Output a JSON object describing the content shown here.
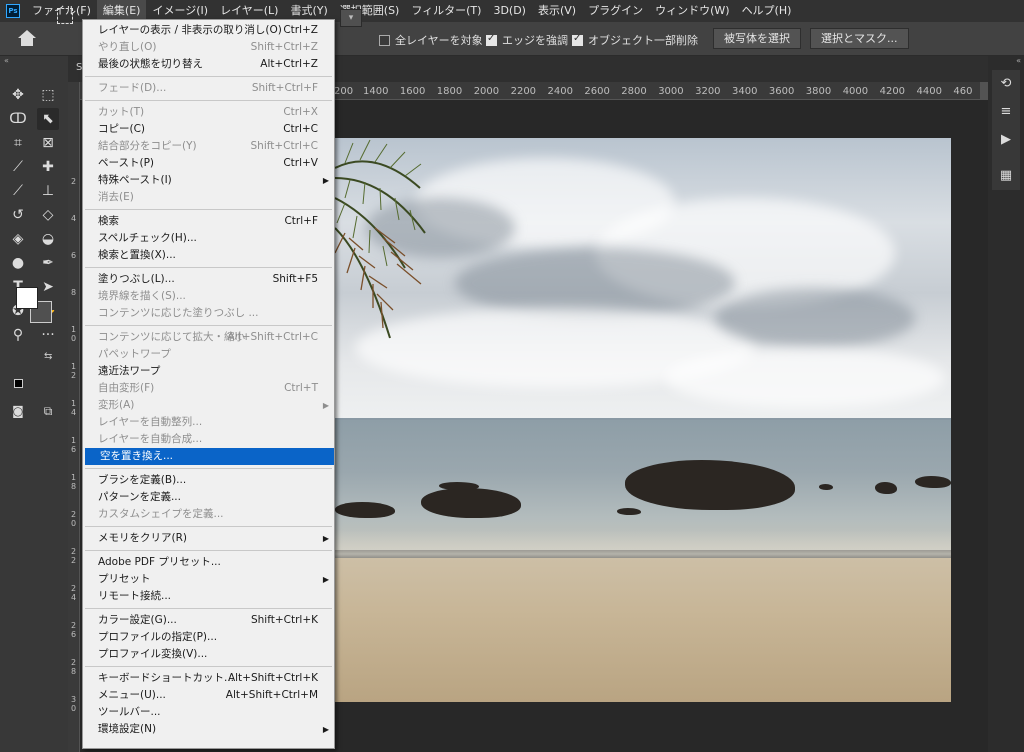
{
  "menubar": {
    "logo": "Ps",
    "items": [
      "ファイル(F)",
      "編集(E)",
      "イメージ(I)",
      "レイヤー(L)",
      "書式(Y)",
      "選択範囲(S)",
      "フィルター(T)",
      "3D(D)",
      "表示(V)",
      "プラグイン",
      "ウィンドウ(W)",
      "ヘルプ(H)"
    ],
    "active_index": 1
  },
  "options": {
    "all_layers": "全レイヤーを対象",
    "edge_enhance": "エッジを強調",
    "object_subtract": "オブジェクト一部削除",
    "select_subject": "被写体を選択",
    "select_and_mask": "選択とマスク..."
  },
  "checkboxes": {
    "all_layers": false,
    "edge_enhance": true,
    "object_subtract": true
  },
  "doc_tab": "S",
  "ruler": {
    "h_ticks": [
      "200",
      "1400",
      "1600",
      "1800",
      "2000",
      "2200",
      "2400",
      "2600",
      "2800",
      "3000",
      "3200",
      "3400",
      "3600",
      "3800",
      "4000",
      "4200",
      "4400",
      "460"
    ],
    "v_labels": [
      [
        "2"
      ],
      [
        "4"
      ],
      [
        "6"
      ],
      [
        "8"
      ],
      [
        "1",
        "0"
      ],
      [
        "1",
        "2"
      ],
      [
        "1",
        "4"
      ],
      [
        "1",
        "6"
      ],
      [
        "1",
        "8"
      ],
      [
        "2",
        "0"
      ],
      [
        "2",
        "2"
      ],
      [
        "2",
        "4"
      ],
      [
        "2",
        "6"
      ],
      [
        "2",
        "8"
      ],
      [
        "3",
        "0"
      ]
    ]
  },
  "colors": {
    "foreground": "#ffffff",
    "background": "#505050",
    "menu_highlight": "#0a64c8"
  },
  "edit_menu": {
    "items": [
      {
        "label": "レイヤーの表示 / 非表示の取り消し(O)",
        "shortcut": "Ctrl+Z",
        "disabled": false
      },
      {
        "label": "やり直し(O)",
        "shortcut": "Shift+Ctrl+Z",
        "disabled": true
      },
      {
        "label": "最後の状態を切り替え",
        "shortcut": "Alt+Ctrl+Z",
        "disabled": false
      },
      {
        "separator": true
      },
      {
        "label": "フェード(D)...",
        "shortcut": "Shift+Ctrl+F",
        "disabled": true
      },
      {
        "separator": true
      },
      {
        "label": "カット(T)",
        "shortcut": "Ctrl+X",
        "disabled": true
      },
      {
        "label": "コピー(C)",
        "shortcut": "Ctrl+C",
        "disabled": false
      },
      {
        "label": "結合部分をコピー(Y)",
        "shortcut": "Shift+Ctrl+C",
        "disabled": true
      },
      {
        "label": "ペースト(P)",
        "shortcut": "Ctrl+V",
        "disabled": false
      },
      {
        "label": "特殊ペースト(I)",
        "submenu": true,
        "disabled": false
      },
      {
        "label": "消去(E)",
        "disabled": true
      },
      {
        "separator": true
      },
      {
        "label": "検索",
        "shortcut": "Ctrl+F",
        "disabled": false
      },
      {
        "label": "スペルチェック(H)...",
        "disabled": false
      },
      {
        "label": "検索と置換(X)...",
        "disabled": false
      },
      {
        "separator": true
      },
      {
        "label": "塗りつぶし(L)...",
        "shortcut": "Shift+F5",
        "disabled": false
      },
      {
        "label": "境界線を描く(S)...",
        "disabled": true
      },
      {
        "label": "コンテンツに応じた塗りつぶし ...",
        "disabled": true
      },
      {
        "separator": true
      },
      {
        "label": "コンテンツに応じて拡大・縮小",
        "shortcut": "Alt+Shift+Ctrl+C",
        "disabled": true
      },
      {
        "label": "パペットワープ",
        "disabled": true
      },
      {
        "label": "遠近法ワープ",
        "disabled": false
      },
      {
        "label": "自由変形(F)",
        "shortcut": "Ctrl+T",
        "disabled": true
      },
      {
        "label": "変形(A)",
        "submenu": true,
        "disabled": true
      },
      {
        "label": "レイヤーを自動整列...",
        "disabled": true
      },
      {
        "label": "レイヤーを自動合成...",
        "disabled": true
      },
      {
        "label": "空を置き換え...",
        "disabled": false,
        "highlighted": true
      },
      {
        "separator": true
      },
      {
        "label": "ブラシを定義(B)...",
        "disabled": false
      },
      {
        "label": "パターンを定義...",
        "disabled": false
      },
      {
        "label": "カスタムシェイプを定義...",
        "disabled": true
      },
      {
        "separator": true
      },
      {
        "label": "メモリをクリア(R)",
        "submenu": true,
        "disabled": false
      },
      {
        "separator": true
      },
      {
        "label": "Adobe PDF プリセット...",
        "disabled": false
      },
      {
        "label": "プリセット",
        "submenu": true,
        "disabled": false
      },
      {
        "label": "リモート接続...",
        "disabled": false
      },
      {
        "separator": true
      },
      {
        "label": "カラー設定(G)...",
        "shortcut": "Shift+Ctrl+K",
        "disabled": false
      },
      {
        "label": "プロファイルの指定(P)...",
        "disabled": false
      },
      {
        "label": "プロファイル変換(V)...",
        "disabled": false
      },
      {
        "separator": true
      },
      {
        "label": "キーボードショートカット...",
        "shortcut": "Alt+Shift+Ctrl+K",
        "disabled": false
      },
      {
        "label": "メニュー(U)...",
        "shortcut": "Alt+Shift+Ctrl+M",
        "disabled": false
      },
      {
        "label": "ツールバー...",
        "disabled": false
      },
      {
        "label": "環境設定(N)",
        "submenu": true,
        "disabled": false
      }
    ]
  }
}
